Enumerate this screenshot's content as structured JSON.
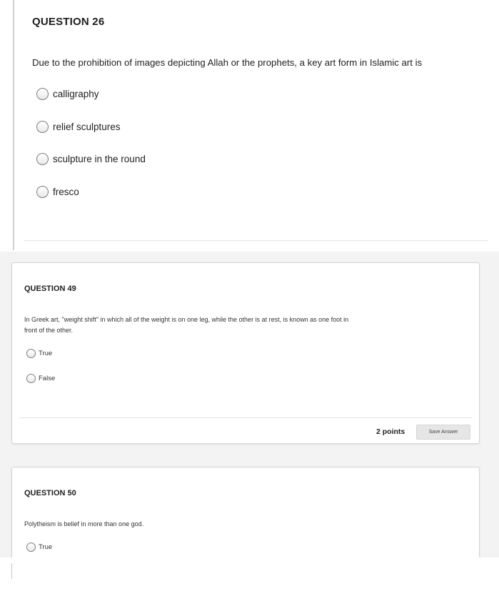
{
  "q26": {
    "title": "QUESTION 26",
    "text": "Due to the prohibition of images depicting Allah or the prophets, a key art form in Islamic art is",
    "options": [
      "calligraphy",
      "relief sculptures",
      "sculpture in the round",
      "fresco"
    ]
  },
  "q49": {
    "title": "QUESTION 49",
    "text_line1": "In Greek art, \"weight shift\" in which all of the weight is on one leg, while the other is at rest, is known as one foot in",
    "text_line2": "front of the other.",
    "options": [
      "True",
      "False"
    ],
    "points": "2 points",
    "save_label": "Save Answer"
  },
  "q50": {
    "title": "QUESTION 50",
    "text": "Polytheism is belief in more than one god.",
    "options": [
      "True"
    ]
  }
}
